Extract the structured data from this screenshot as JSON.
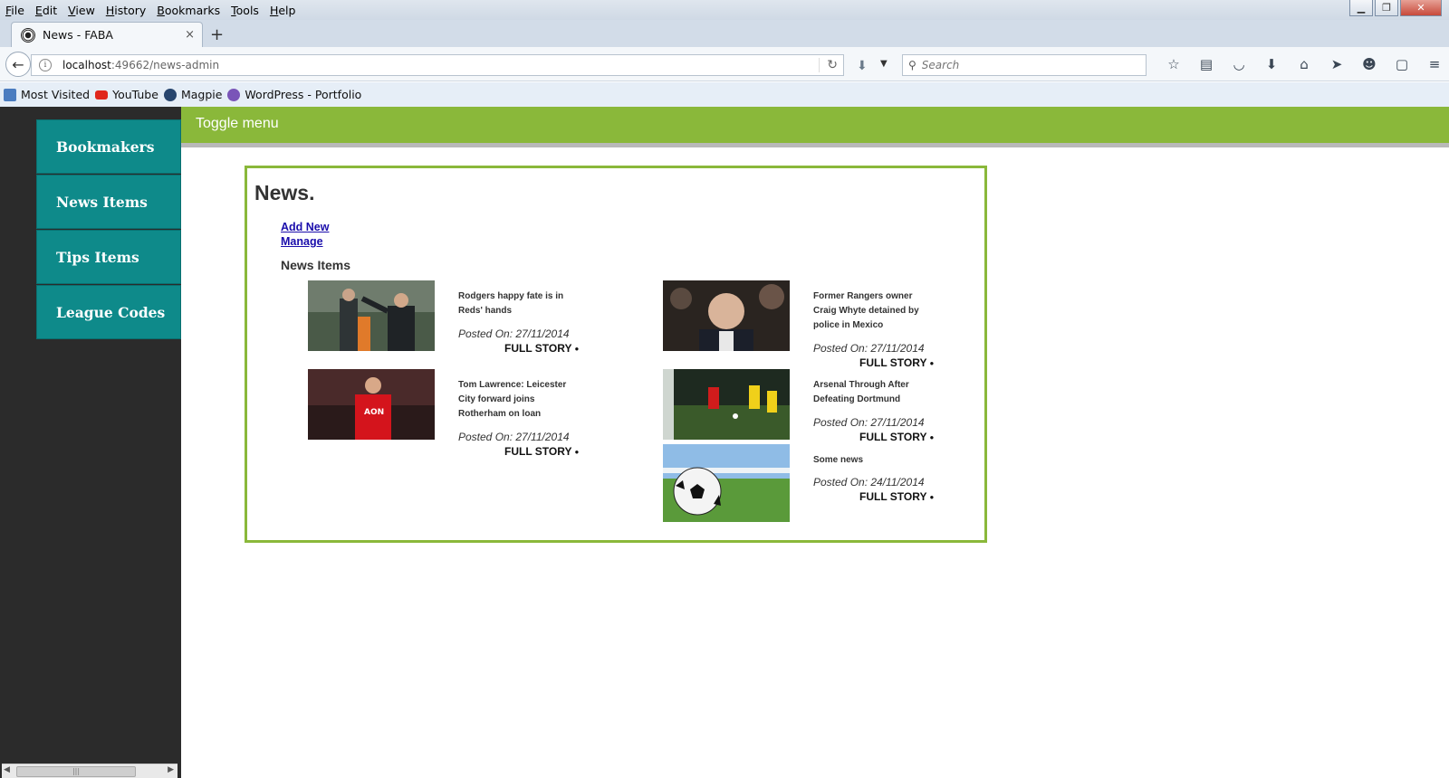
{
  "menubar": {
    "items": [
      "File",
      "Edit",
      "View",
      "History",
      "Bookmarks",
      "Tools",
      "Help"
    ]
  },
  "tab": {
    "title": "News - FABA",
    "close_glyph": "×",
    "new_tab_glyph": "+"
  },
  "navbar": {
    "url_host": "localhost",
    "url_path": ":49662/news-admin",
    "search_placeholder": "Search"
  },
  "bookmarks": [
    {
      "label": "Most Visited",
      "icon": "most-visited-icon"
    },
    {
      "label": "YouTube",
      "icon": "youtube-icon"
    },
    {
      "label": "Magpie",
      "icon": "magpie-icon"
    },
    {
      "label": "WordPress - Portfolio",
      "icon": "wordpress-icon"
    }
  ],
  "sidebar": {
    "items": [
      {
        "label": "Bookmakers"
      },
      {
        "label": "News Items"
      },
      {
        "label": "Tips Items"
      },
      {
        "label": "League Codes"
      }
    ]
  },
  "topbar": {
    "toggle_label": "Toggle menu"
  },
  "content": {
    "title": "News.",
    "add_new": "Add New",
    "manage": "Manage",
    "section_title": "News Items",
    "items": [
      {
        "headline": "Rodgers happy fate is in Reds' hands",
        "date": "Posted On: 27/11/2014",
        "more": "FULL STORY",
        "image": "manager-touchline-photo"
      },
      {
        "headline": "Former Rangers owner Craig Whyte detained by police in Mexico",
        "date": "Posted On: 27/11/2014",
        "more": "FULL STORY",
        "image": "man-in-crowd-photo"
      },
      {
        "headline": "Tom Lawrence: Leicester City forward joins Rotherham on loan",
        "date": "Posted On: 27/11/2014",
        "more": "FULL STORY",
        "image": "player-red-shirt-photo"
      },
      {
        "headline": "Arsenal Through After Defeating Dortmund",
        "date": "Posted On: 27/11/2014",
        "more": "FULL STORY",
        "image": "match-action-photo"
      },
      {
        "headline": "Some news",
        "date": "Posted On: 24/11/2014",
        "more": "FULL STORY",
        "image": "football-on-grass-photo"
      }
    ]
  },
  "colors": {
    "sidebar_bg": "#2b2b2b",
    "sidebar_item": "#0e8a8a",
    "accent_green": "#8ab83a"
  }
}
